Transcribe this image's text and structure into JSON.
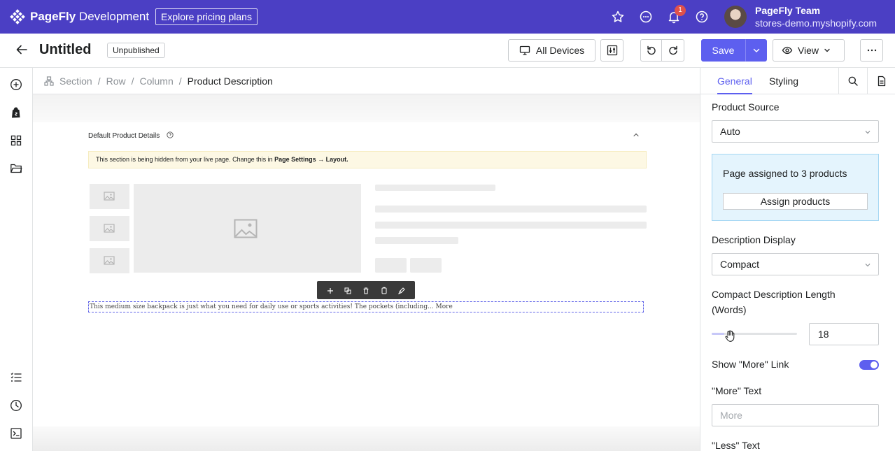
{
  "topbar": {
    "brand_main": "PageFly",
    "brand_sub": " Development",
    "pricing_label": "Explore pricing plans",
    "notification_count": "1",
    "account_name": "PageFly Team",
    "account_store": "stores-demo.myshopify.com",
    "icons": [
      "star-icon",
      "chat-icon",
      "bell-icon",
      "help-icon"
    ]
  },
  "header": {
    "title": "Untitled",
    "status": "Unpublished",
    "devices_label": "All Devices",
    "save_label": "Save",
    "view_label": "View"
  },
  "breadcrumb": {
    "items": [
      "Section",
      "Row",
      "Column"
    ],
    "current": "Product Description"
  },
  "canvas": {
    "section_title": "Default Product Details",
    "notice_text": "This section is being hidden from your live page. Change this in ",
    "notice_bold": "Page Settings → Layout.",
    "description": "This medium size backpack is just what you need for daily use or sports activities! The pockets (including... More"
  },
  "panel": {
    "tabs": [
      "General",
      "Styling"
    ],
    "product_source_label": "Product Source",
    "product_source_value": "Auto",
    "assigned_text": "Page assigned to 3 products",
    "assign_button": "Assign products",
    "description_display_label": "Description Display",
    "description_display_value": "Compact",
    "compact_length_label_1": "Compact Description Length",
    "compact_length_label_2": "(Words)",
    "compact_length_value": "18",
    "compact_length_slider_fraction": 0.15,
    "show_more_label": "Show \"More\" Link",
    "show_more_enabled": true,
    "more_text_label": "\"More\" Text",
    "more_text_placeholder": "More",
    "less_text_label": "\"Less\" Text"
  },
  "colors": {
    "topbar": "#4b3fc4",
    "accent": "#5d5fef",
    "notice_bg": "#fdf8e4",
    "info_bg": "#e4f4fd"
  }
}
